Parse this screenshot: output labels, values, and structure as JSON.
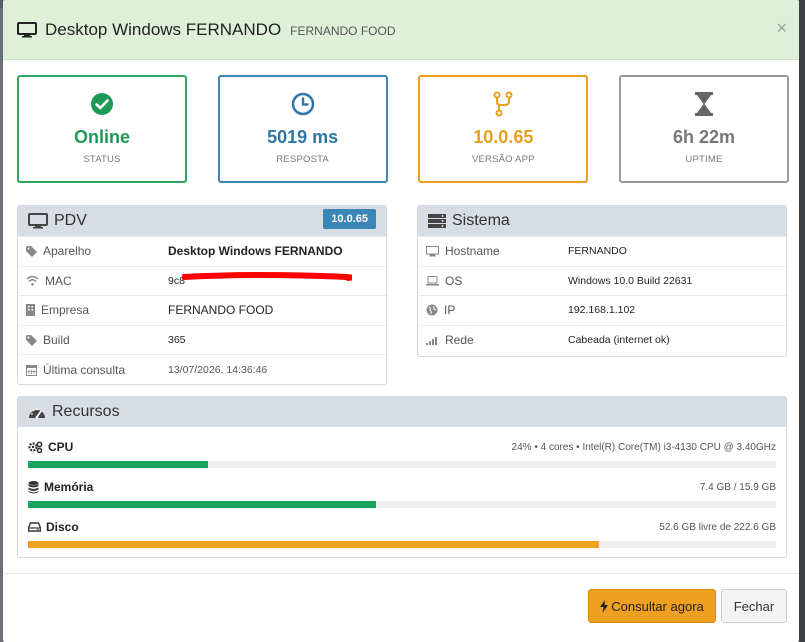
{
  "modal": {
    "title": "Desktop Windows FERNANDO",
    "subtitle": "FERNANDO FOOD",
    "close_label": "×"
  },
  "cards": [
    {
      "value": "Online",
      "label": "STATUS",
      "icon": "check-circle-icon",
      "color": "#1d9a55"
    },
    {
      "value": "5019 ms",
      "label": "RESPOSTA",
      "icon": "clock-icon",
      "color": "#2d76a6"
    },
    {
      "value": "10.0.65",
      "label": "VERSÃO APP",
      "icon": "code-fork-icon",
      "color": "#e8a020"
    },
    {
      "value": "6h 22m",
      "label": "UPTIME",
      "icon": "hourglass-icon",
      "color": "#777777"
    }
  ],
  "pdv": {
    "title": "PDV",
    "version_badge": "10.0.65",
    "rows": [
      {
        "key": "Aparelho",
        "value": "Desktop Windows FERNANDO",
        "icon": "tag-icon"
      },
      {
        "key": "MAC",
        "value": "9c8",
        "icon": "wifi-icon"
      },
      {
        "key": "Empresa",
        "value": "FERNANDO FOOD",
        "icon": "building-icon"
      },
      {
        "key": "Build",
        "value": "365",
        "icon": "tag-icon"
      },
      {
        "key": "Última consulta",
        "value": "13/07/2026, 14:36:46",
        "icon": "calendar-icon"
      }
    ]
  },
  "sistema": {
    "title": "Sistema",
    "rows": [
      {
        "key": "Hostname",
        "value": "FERNANDO",
        "icon": "desktop-icon"
      },
      {
        "key": "OS",
        "value": "Windows 10.0 Build 22631",
        "icon": "laptop-icon"
      },
      {
        "key": "IP",
        "value": "192.168.1.102",
        "icon": "globe-icon"
      },
      {
        "key": "Rede",
        "value": "Cabeada (internet ok)",
        "icon": "signal-icon"
      }
    ]
  },
  "recursos": {
    "title": "Recursos",
    "items": [
      {
        "name": "CPU",
        "info": "24% • 4 cores • Intel(R) Core(TM) i3-4130 CPU @ 3.40GHz",
        "percent": 24,
        "color": "#1aa35a",
        "icon": "cogs-icon"
      },
      {
        "name": "Memória",
        "info": "7.4 GB / 15.9 GB",
        "percent": 46.5,
        "color": "#1aa35a",
        "icon": "database-icon"
      },
      {
        "name": "Disco",
        "info": "52.6 GB livre de 222.6 GB",
        "percent": 76.4,
        "color": "#f0a020",
        "icon": "hdd-icon"
      }
    ]
  },
  "footer": {
    "primary_label": "Consultar agora",
    "primary_icon": "bolt-icon",
    "close_label": "Fechar"
  }
}
